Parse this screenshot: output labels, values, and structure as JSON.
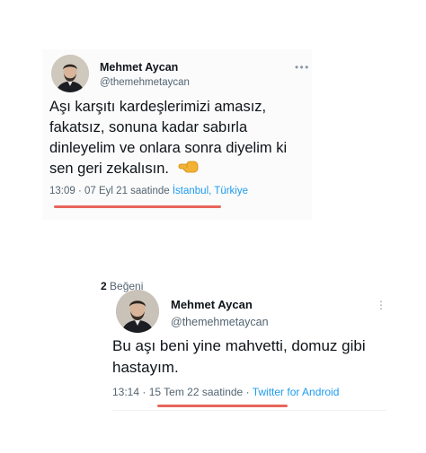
{
  "tweet1": {
    "author_name": "Mehmet Aycan",
    "author_handle": "@themehmetaycan",
    "text": "Aşı karşıtı kardeşlerimizi amasız, fakatsız, sonuna kadar sabırla dinleyelim ve onlara sonra diyelim ki sen geri zekalısın.",
    "emoji": "pointing-hand-left-emoji",
    "time": "13:09",
    "separator": " · ",
    "date": "07 Eyl 21 saatinde",
    "location": "İstanbul, Türkiye",
    "more_icon": "more-horizontal-icon"
  },
  "tweet2": {
    "author_name": "Mehmet Aycan",
    "author_handle": "@themehmetaycan",
    "text": "Bu aşı beni yine mahvetti, domuz gibi hastayım.",
    "time": "13:14",
    "separator": " · ",
    "date": "15 Tem 22 saatinde",
    "source": "Twitter for Android",
    "likes_count": "2",
    "likes_label": "Beğeni",
    "more_icon": "more-horizontal-icon"
  },
  "colors": {
    "underline": "#e8665c",
    "link": "#1d9bf0",
    "secondary_text": "#536471",
    "primary_text": "#0f1419"
  }
}
